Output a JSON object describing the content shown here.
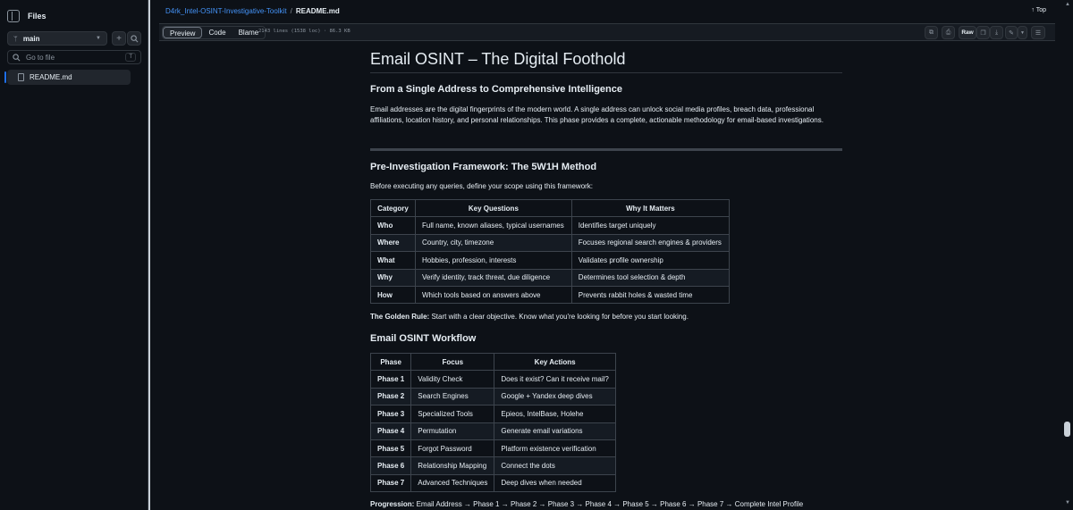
{
  "sidebar": {
    "title": "Files",
    "branch": "main",
    "add_label": "+",
    "search_placeholder": "Go to file",
    "shortcut": "T",
    "files": [
      "README.md"
    ]
  },
  "breadcrumb": {
    "repo": "D4rk_Intel-OSINT-Investigative-Toolkit",
    "separator": "/",
    "file": "README.md"
  },
  "top_link": "Top",
  "toolbar": {
    "tabs": [
      "Preview",
      "Code",
      "Blame"
    ],
    "line_info": "2143 lines (1538 loc) · 86.3 KB",
    "raw_label": "Raw"
  },
  "doc": {
    "title": "Email OSINT – The Digital Foothold",
    "subtitle": "From a Single Address to Comprehensive Intelligence",
    "intro": "Email addresses are the digital fingerprints of the modern world. A single address can unlock social media profiles, breach data, professional affiliations, location history, and personal relationships. This phase provides a complete, actionable methodology for email-based investigations.",
    "framework_heading": "Pre-Investigation Framework: The 5W1H Method",
    "framework_intro": "Before executing any queries, define your scope using this framework:",
    "framework_table": {
      "headers": [
        "Category",
        "Key Questions",
        "Why It Matters"
      ],
      "rows": [
        [
          "Who",
          "Full name, known aliases, typical usernames",
          "Identifies target uniquely"
        ],
        [
          "Where",
          "Country, city, timezone",
          "Focuses regional search engines & providers"
        ],
        [
          "What",
          "Hobbies, profession, interests",
          "Validates profile ownership"
        ],
        [
          "Why",
          "Verify identity, track threat, due diligence",
          "Determines tool selection & depth"
        ],
        [
          "How",
          "Which tools based on answers above",
          "Prevents rabbit holes & wasted time"
        ]
      ]
    },
    "golden_rule_label": "The Golden Rule:",
    "golden_rule_text": " Start with a clear objective. Know what you're looking for before you start looking.",
    "workflow_heading": "Email OSINT Workflow",
    "workflow_table": {
      "headers": [
        "Phase",
        "Focus",
        "Key Actions"
      ],
      "rows": [
        [
          "Phase 1",
          "Validity Check",
          "Does it exist? Can it receive mail?"
        ],
        [
          "Phase 2",
          "Search Engines",
          "Google + Yandex deep dives"
        ],
        [
          "Phase 3",
          "Specialized Tools",
          "Epieos, IntelBase, Holehe"
        ],
        [
          "Phase 4",
          "Permutation",
          "Generate email variations"
        ],
        [
          "Phase 5",
          "Forgot Password",
          "Platform existence verification"
        ],
        [
          "Phase 6",
          "Relationship Mapping",
          "Connect the dots"
        ],
        [
          "Phase 7",
          "Advanced Techniques",
          "Deep dives when needed"
        ]
      ]
    },
    "progression_label": "Progression:",
    "progression_text": " Email Address → Phase 1 → Phase 2 → Phase 3 → Phase 4 → Phase 5 → Phase 6 → Phase 7 → Complete Intel Profile"
  }
}
